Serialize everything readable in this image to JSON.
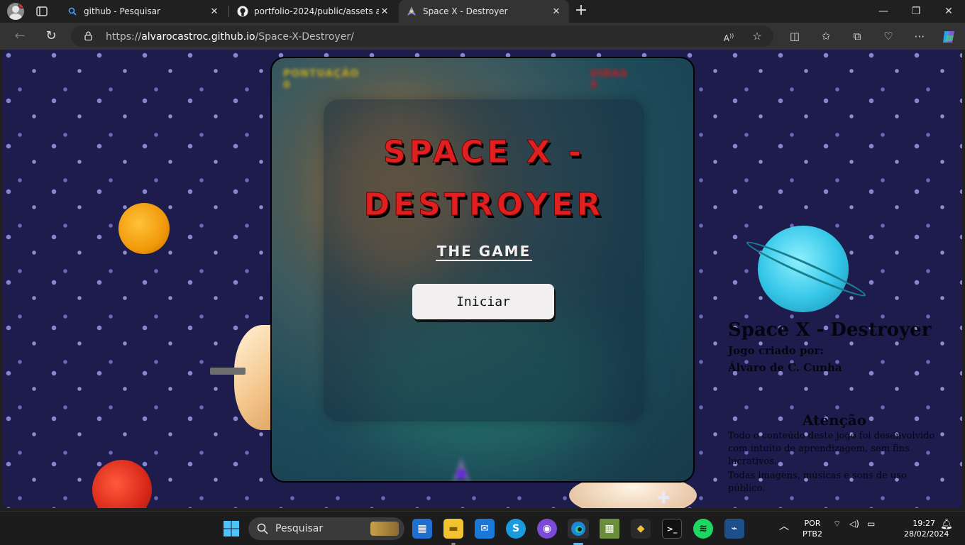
{
  "browser": {
    "tabs": [
      {
        "title": "github - Pesquisar",
        "icon": "search-icon",
        "active": false
      },
      {
        "title": "portfolio-2024/public/assets at m",
        "icon": "github-icon",
        "active": false
      },
      {
        "title": "Space X - Destroyer",
        "icon": "page-favicon",
        "active": true
      }
    ],
    "url_scheme": "https://",
    "url_host": "alvarocastroc.github.io",
    "url_path": "/Space-X-Destroyer/"
  },
  "game": {
    "hud_score_label": "PONTUAÇÃO",
    "hud_score_value": "0",
    "hud_life_label": "VIDAS",
    "hud_life_value": "3",
    "title": "Space X - Destroyer",
    "subtitle": "The Game",
    "start_label": "Iniciar"
  },
  "side_info": {
    "title": "Space X - Destroyer",
    "created_by_line1": "Jogo criado por:",
    "created_by_line2": "Álvaro de C. Cunha",
    "attention_title": "Atenção",
    "text_line1": "Todo o conteúdo deste jogo foi desenvolvido com intuito de aprendizagem, sem fins lucrativos.",
    "text_line2": "Todas imagens, músicas e sons de uso público."
  },
  "taskbar": {
    "search_label": "Pesquisar",
    "lang_line1": "POR",
    "lang_line2": "PTB2",
    "time": "19:27",
    "date": "28/02/2024"
  },
  "colors": {
    "title_red": "#e02020",
    "space_bg": "#1e1c4d",
    "edge_accent": "#0078d4"
  }
}
